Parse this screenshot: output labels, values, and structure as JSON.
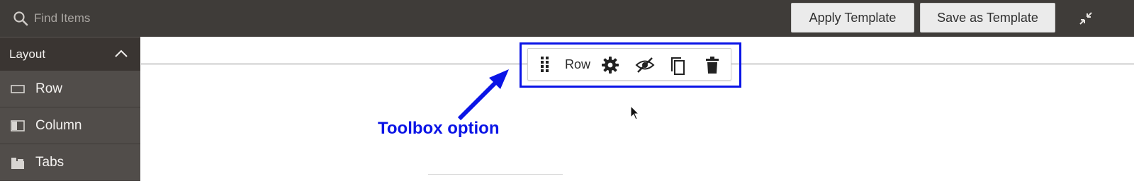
{
  "search": {
    "placeholder": "Find Items"
  },
  "header": {
    "apply_template_label": "Apply Template",
    "save_template_label": "Save as Template"
  },
  "sidebar": {
    "section_title": "Layout",
    "items": [
      {
        "label": "Row",
        "icon": "row-icon"
      },
      {
        "label": "Column",
        "icon": "column-icon"
      },
      {
        "label": "Tabs",
        "icon": "tabs-icon"
      }
    ]
  },
  "toolbox": {
    "label": "Row",
    "actions": [
      "drag-handle-icon",
      "gear-icon",
      "hide-icon",
      "duplicate-icon",
      "trash-icon"
    ]
  },
  "annotation": {
    "text": "Toolbox option"
  },
  "colors": {
    "topbar": "#3f3c39",
    "sidebar": "#514d4a",
    "sidebar_header": "#3a3532",
    "annotation_blue": "#0a14e6",
    "button_bg": "#ebebeb"
  }
}
